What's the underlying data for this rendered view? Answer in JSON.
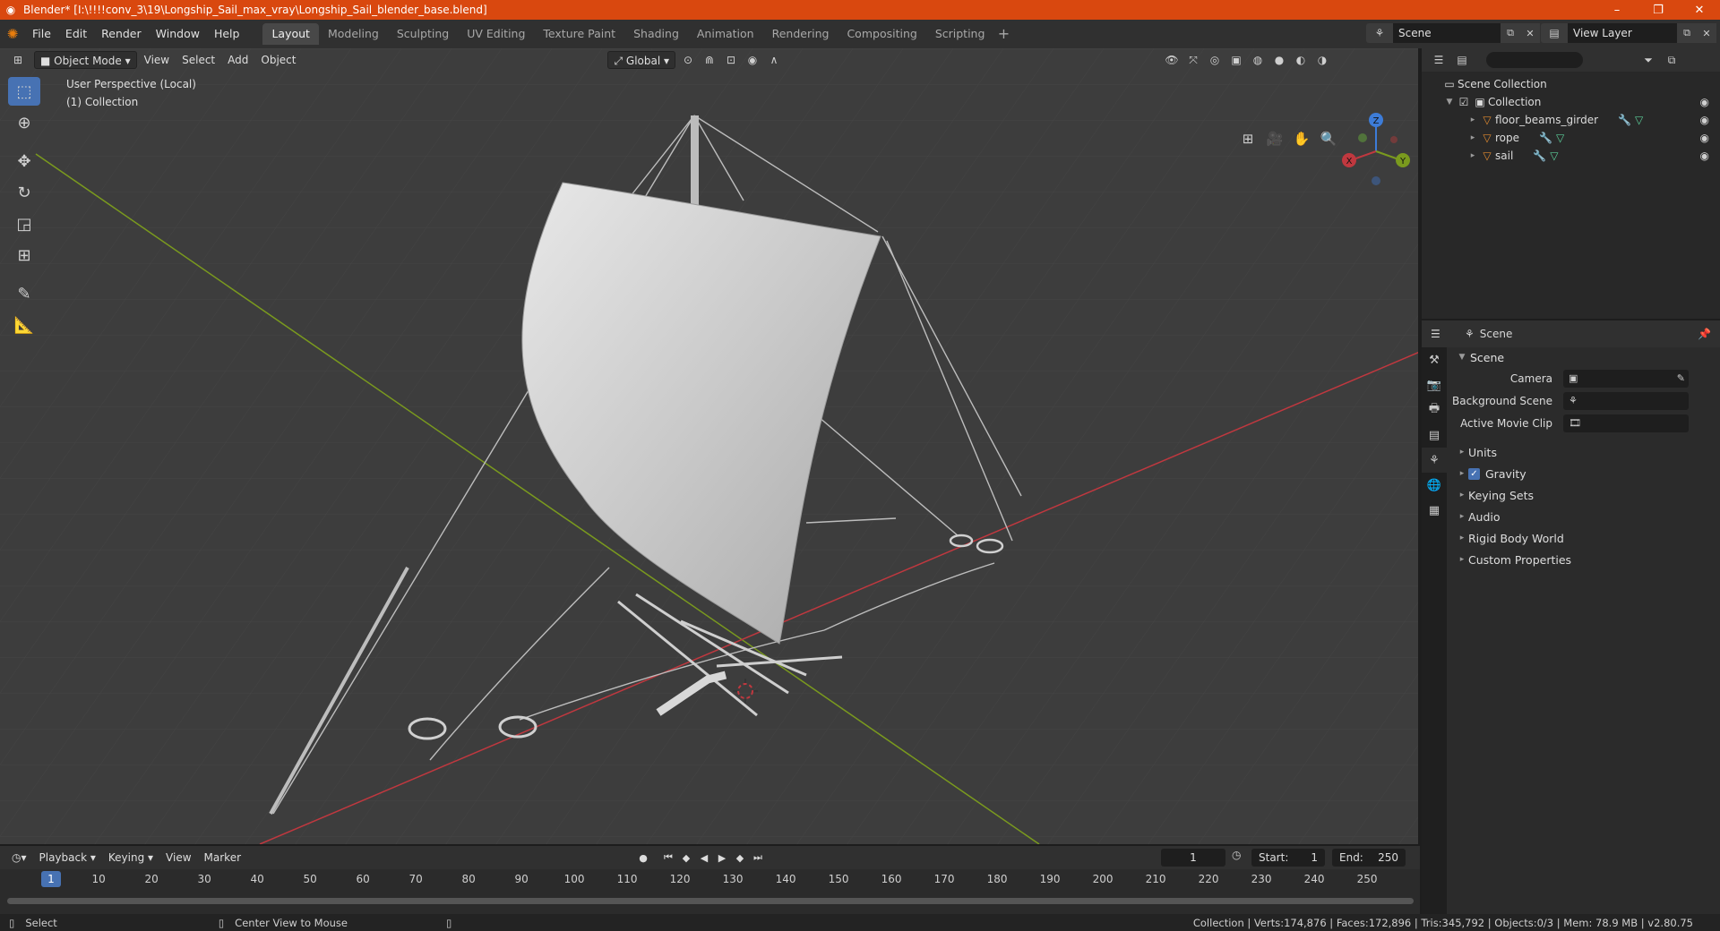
{
  "window": {
    "title": "Blender* [I:\\!!!!conv_3\\19\\Longship_Sail_max_vray\\Longship_Sail_blender_base.blend]",
    "controls": [
      "–",
      "❐",
      "✕"
    ]
  },
  "topbar": {
    "menus": [
      "File",
      "Edit",
      "Render",
      "Window",
      "Help"
    ],
    "workspaces": [
      "Layout",
      "Modeling",
      "Sculpting",
      "UV Editing",
      "Texture Paint",
      "Shading",
      "Animation",
      "Rendering",
      "Compositing",
      "Scripting"
    ],
    "active_workspace": "Layout",
    "scene_name": "Scene",
    "view_layer_name": "View Layer"
  },
  "viewport": {
    "mode": "Object Mode",
    "menus": [
      "View",
      "Select",
      "Add",
      "Object"
    ],
    "transform_orientation": "Global",
    "info_line1": "User Perspective (Local)",
    "info_line2": "(1) Collection",
    "gizmo_axes": [
      "X",
      "Y",
      "Z"
    ]
  },
  "outliner": {
    "search_placeholder": "",
    "root": "Scene Collection",
    "collection": "Collection",
    "objects": [
      "floor_beams_girder",
      "rope",
      "sail"
    ]
  },
  "properties": {
    "context": "Scene",
    "panel_title": "Scene",
    "fields": [
      {
        "label": "Camera",
        "value": ""
      },
      {
        "label": "Background Scene",
        "value": ""
      },
      {
        "label": "Active Movie Clip",
        "value": ""
      }
    ],
    "subpanels": [
      "Units",
      "Gravity",
      "Keying Sets",
      "Audio",
      "Rigid Body World",
      "Custom Properties"
    ],
    "gravity_enabled": true
  },
  "timeline": {
    "menus": [
      "Playback",
      "Keying",
      "View",
      "Marker"
    ],
    "current_frame": "1",
    "start_label": "Start:",
    "start_value": "1",
    "end_label": "End:",
    "end_value": "250",
    "ticks": [
      "1",
      "10",
      "20",
      "30",
      "40",
      "50",
      "60",
      "70",
      "80",
      "90",
      "100",
      "110",
      "120",
      "130",
      "140",
      "150",
      "160",
      "170",
      "180",
      "190",
      "200",
      "210",
      "220",
      "230",
      "240",
      "250"
    ]
  },
  "statusbar": {
    "left1": "Select",
    "left2": "Center View to Mouse",
    "right": "Collection | Verts:174,876 | Faces:172,896 | Tris:345,792 | Objects:0/3 | Mem: 78.9 MB | v2.80.75"
  },
  "colors": {
    "titlebar": "#d9480f",
    "accent": "#4772b3",
    "x_axis": "#c0383f",
    "y_axis": "#7a9a1e"
  }
}
